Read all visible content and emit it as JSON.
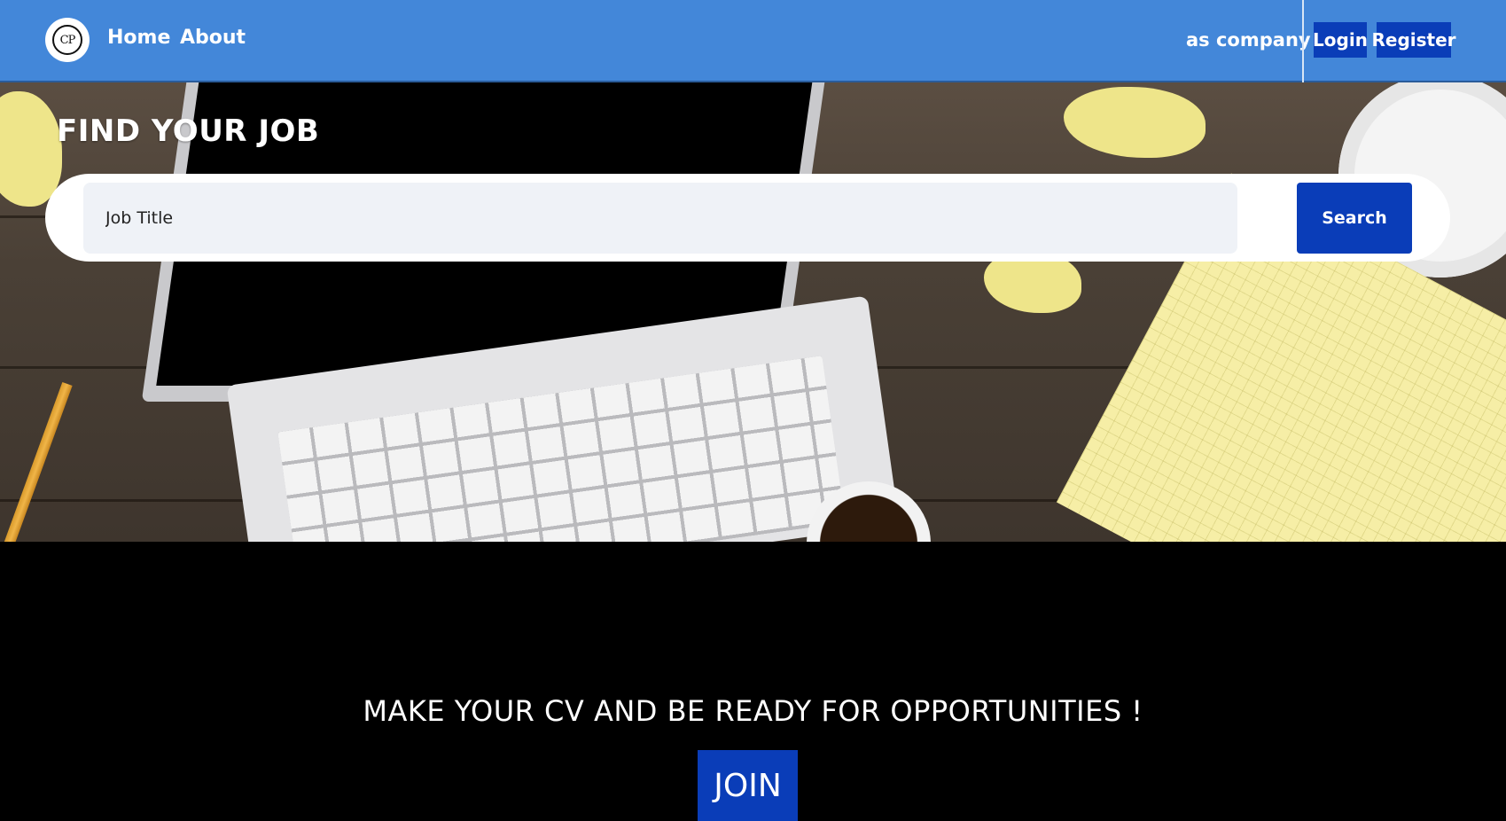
{
  "nav": {
    "logo_text": "CP",
    "home": "Home",
    "about": "About",
    "as_company": "as company",
    "login": "Login",
    "register": "Register"
  },
  "hero": {
    "title": "FIND YOUR JOB",
    "search_placeholder": "Job Title",
    "search_button": "Search"
  },
  "cta": {
    "title": "MAKE YOUR CV AND BE READY FOR OPPORTUNITIES !",
    "join_button": "JOIN"
  },
  "colors": {
    "navbar": "#4387d9",
    "button": "#0a3db8",
    "page_background": "#000000"
  }
}
